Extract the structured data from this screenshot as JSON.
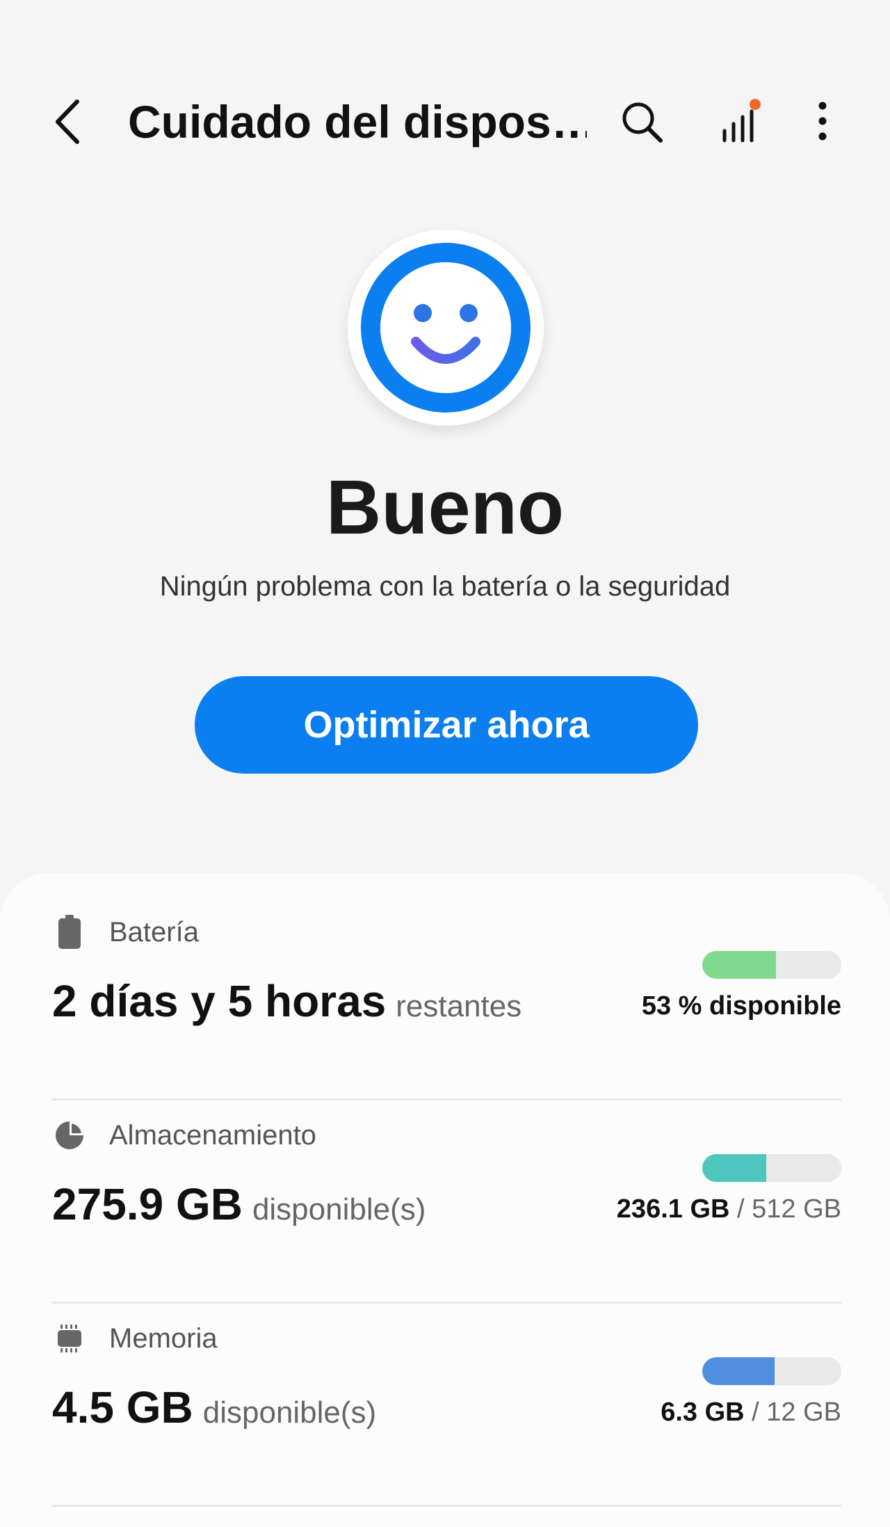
{
  "header": {
    "title": "Cuidado del dispos…",
    "back_icon": "chevron-left-icon",
    "search_icon": "search-icon",
    "stats_icon": "bar-chart-icon",
    "more_icon": "more-vertical-icon",
    "notification_dot_color": "#f26522"
  },
  "status": {
    "icon": "smiley-icon",
    "title": "Bueno",
    "subtitle": "Ningún problema con la batería o la seguridad",
    "ring_color": "#0b7ef0"
  },
  "optimize_button": {
    "label": "Optimizar ahora",
    "color": "#0b7ef0"
  },
  "items": [
    {
      "label": "Batería",
      "icon": "battery-icon",
      "value": "2 días y 5 horas",
      "value_suffix": "restantes",
      "right_primary": "53 % disponible",
      "right_secondary": "",
      "fill_percent": 53,
      "fill_color": "#7fd98f"
    },
    {
      "label": "Almacenamiento",
      "icon": "pie-chart-icon",
      "value": "275.9 GB",
      "value_suffix": "disponible(s)",
      "right_primary": "236.1 GB",
      "right_secondary": "/ 512 GB",
      "fill_percent": 46,
      "fill_color": "#4fc6bd"
    },
    {
      "label": "Memoria",
      "icon": "memory-chip-icon",
      "value": "4.5 GB",
      "value_suffix": "disponible(s)",
      "right_primary": "6.3 GB",
      "right_secondary": "/ 12 GB",
      "fill_percent": 52,
      "fill_color": "#4f8fde"
    }
  ]
}
